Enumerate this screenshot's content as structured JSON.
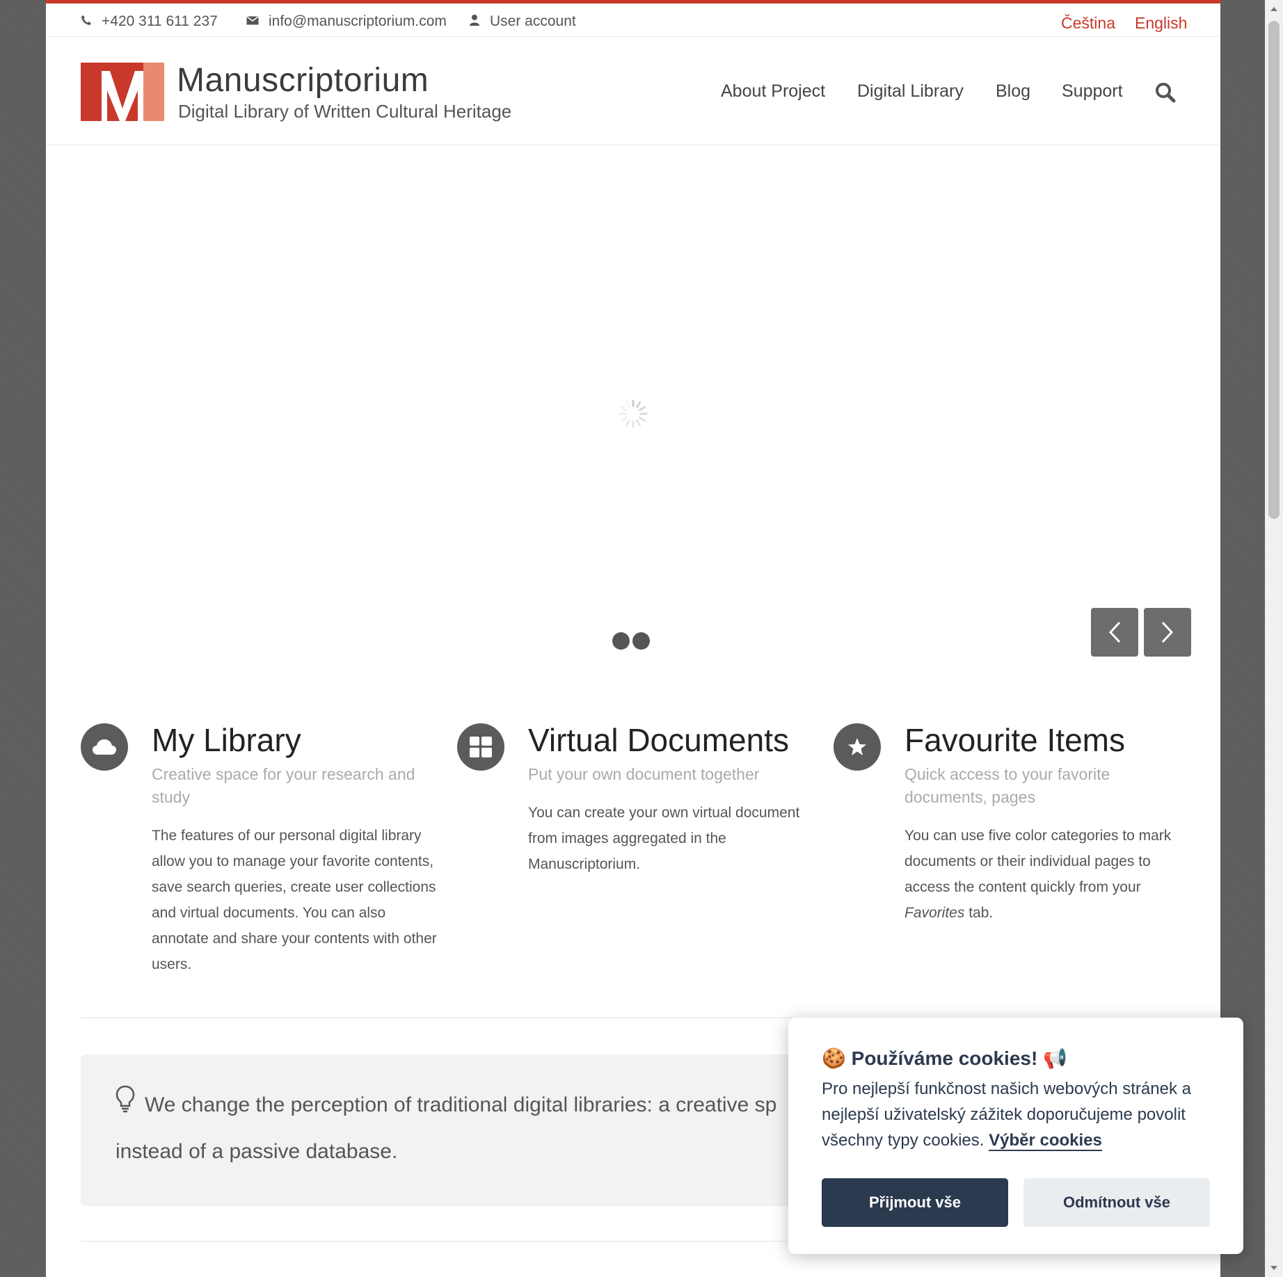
{
  "topbar": {
    "phone": "+420 311 611 237",
    "email": "info@manuscriptorium.com",
    "account": "User account",
    "languages": [
      "Čeština",
      "English"
    ]
  },
  "brand": {
    "name": "Manuscriptorium",
    "tagline": "Digital Library of Written Cultural Heritage",
    "accent_color": "#c8392b"
  },
  "nav": {
    "items": [
      "About Project",
      "Digital Library",
      "Blog",
      "Support"
    ],
    "search_icon": "search-icon"
  },
  "slider": {
    "slide_count": 2,
    "prev_icon": "chevron-left-icon",
    "next_icon": "chevron-right-icon"
  },
  "features": [
    {
      "icon": "cloud-icon",
      "title": "My Library",
      "subtitle": "Creative space for your research and study",
      "text": "The features of our personal digital library allow you to manage your favorite contents, save search queries, create user collections and virtual documents. You can also annotate and share your contents with other users."
    },
    {
      "icon": "grid-icon",
      "title": "Virtual Documents",
      "subtitle": "Put your own document together",
      "text": "You can create your own virtual document from images aggregated in the Manuscriptorium."
    },
    {
      "icon": "star-icon",
      "title": "Favourite Items",
      "subtitle": "Quick access to your favorite documents, pages",
      "text_before": "You can use five color categories to mark documents or their individual pages to access the content quickly from your ",
      "text_em": "Favorites",
      "text_after": " tab."
    }
  ],
  "quote": {
    "icon": "lightbulb-icon",
    "text": "We change the perception of traditional digital libraries: a creative sp",
    "text_line2": "instead of a passive database."
  },
  "cookie": {
    "title": "🍪 Používáme cookies! 📢",
    "text": "Pro nejlepší funkčnost našich webových stránek a nejlepší uživatelský zážitek doporučujeme povolit všechny typy cookies.",
    "link": "Výběr cookies",
    "accept": "Přijmout vše",
    "reject": "Odmítnout vše",
    "primary_color": "#2b3a4e"
  }
}
